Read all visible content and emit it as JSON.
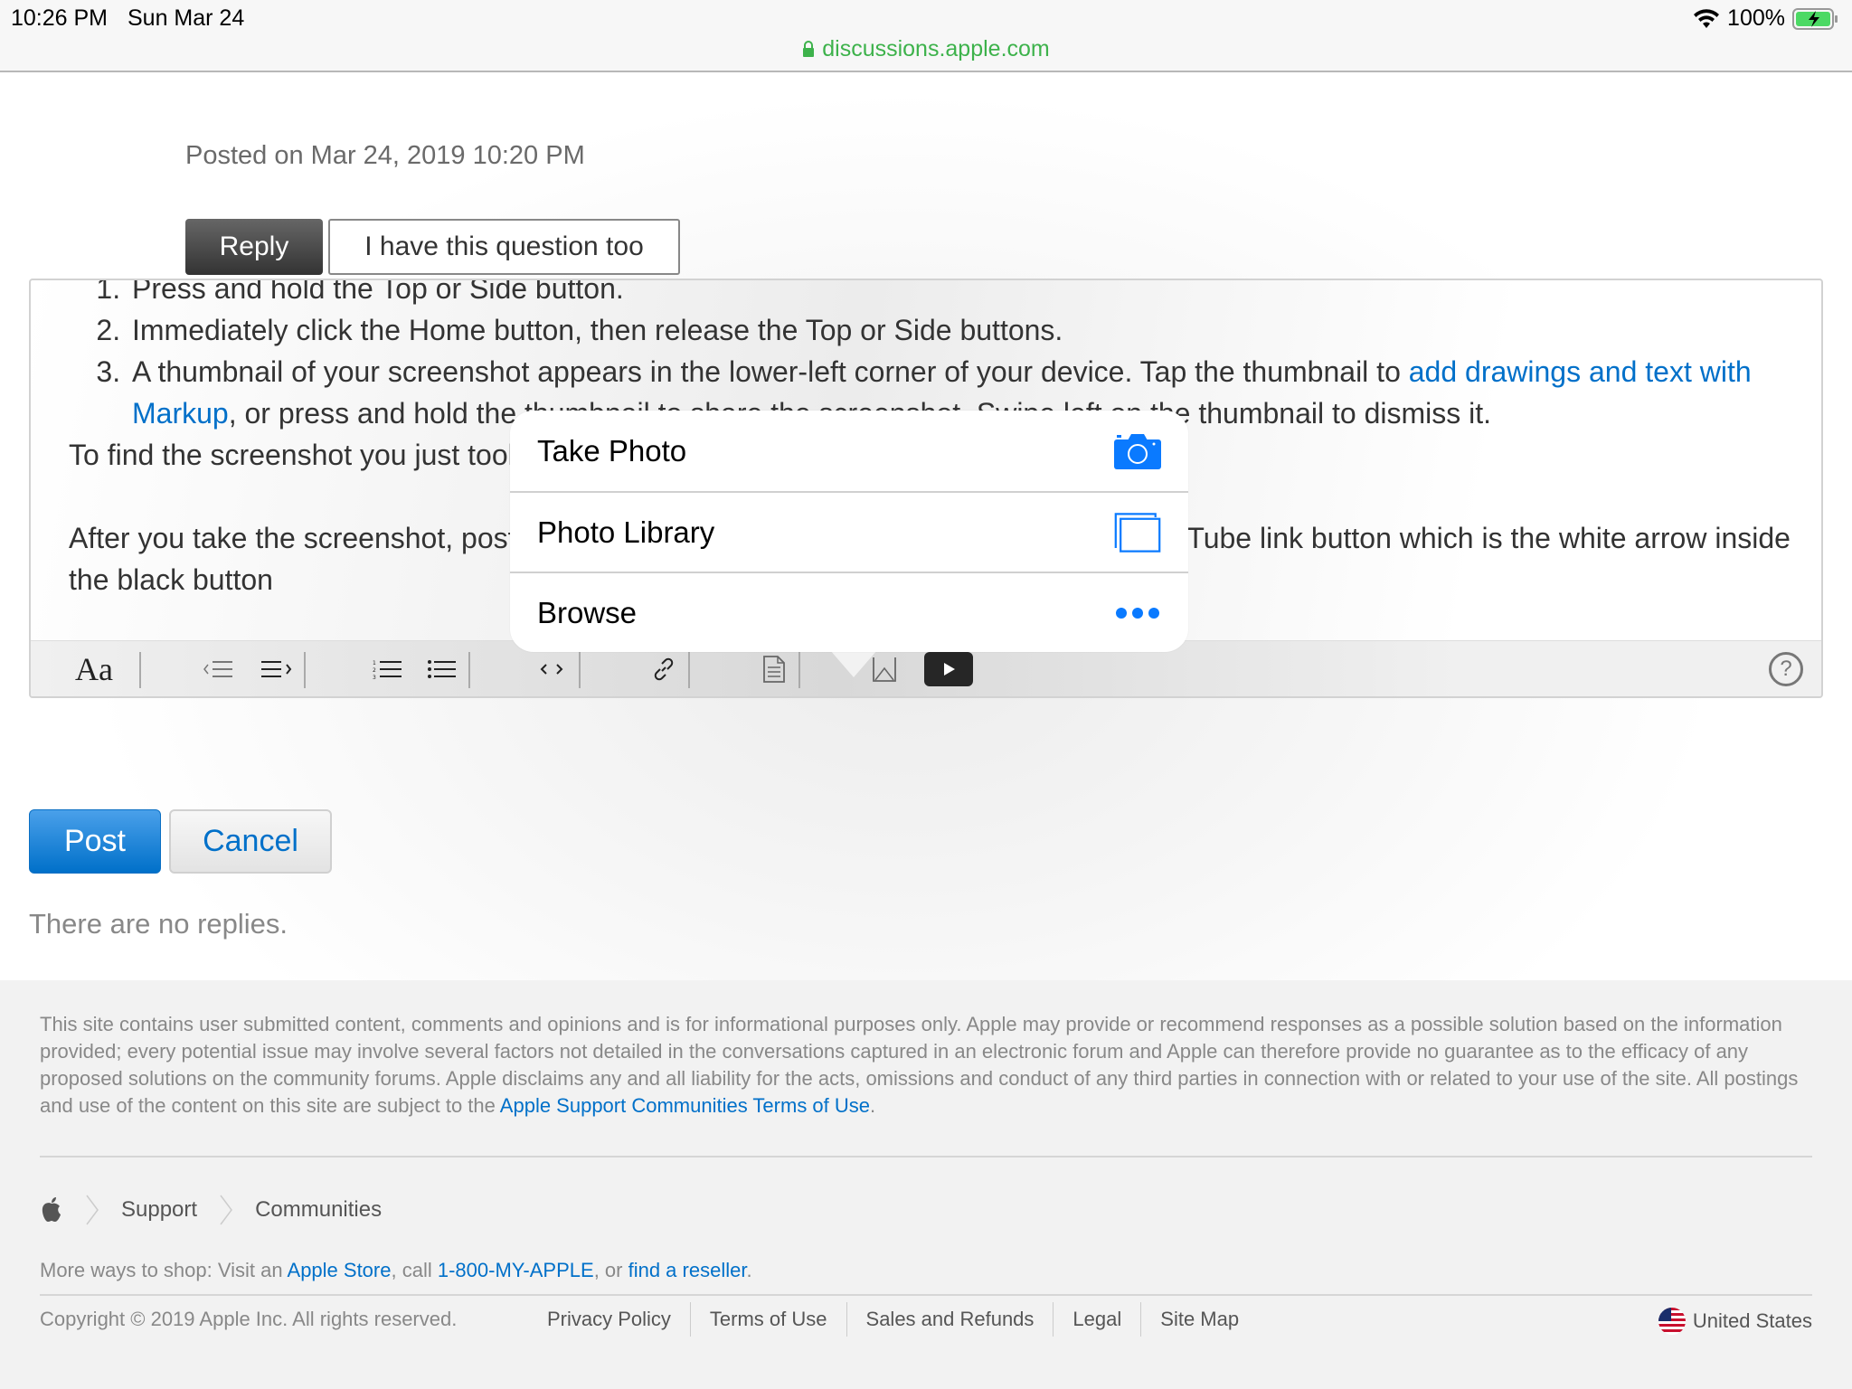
{
  "status_bar": {
    "time": "10:26 PM",
    "date": "Sun Mar 24",
    "battery": "100%",
    "url": "discussions.apple.com"
  },
  "post": {
    "posted": "Posted on Mar 24, 2019 10:20 PM",
    "reply_label": "Reply",
    "question_label": "I have this question too"
  },
  "editor": {
    "list_items": [
      {
        "text": "Press and hold the Top or Side button."
      },
      {
        "text": "Immediately click the Home button, then release the Top or Side buttons."
      },
      {
        "before": "A thumbnail of your screenshot appears in the lower-left corner of your device. Tap the thumbnail to ",
        "link": "add drawings and text with Markup",
        "after": ", or press and hold the thumbnail to share the screenshot. Swipe left on the thumbnail to dismiss it."
      }
    ],
    "paragraph1": "To find the screenshot you just took, go to Photos > Albums and tap Screenshots",
    "paragraph2": "After you take the screenshot, post it here using the Insert Image button next to the YouTube link button which is the white arrow inside the black button",
    "toolbar": {
      "font_label": "Aa",
      "help": "?"
    }
  },
  "popover": {
    "items": [
      {
        "label": "Take Photo",
        "icon": "camera-icon"
      },
      {
        "label": "Photo Library",
        "icon": "photo-library-icon"
      },
      {
        "label": "Browse",
        "icon": "more-icon"
      }
    ],
    "accent": "#0a7aff"
  },
  "actions": {
    "post_label": "Post",
    "cancel_label": "Cancel",
    "no_replies": "There are no replies."
  },
  "footer": {
    "disclaimer_text": "This site contains user submitted content, comments and opinions and is for informational purposes only. Apple may provide or recommend responses as a possible solution based on the information provided; every potential issue may involve several factors not detailed in the conversations captured in an electronic forum and Apple can therefore provide no guarantee as to the efficacy of any proposed solutions on the community forums. Apple disclaims any and all liability for the acts, omissions and conduct of any third parties in connection with or related to your use of the site. All postings and use of the content on this site are subject to the ",
    "disclaimer_link": "Apple Support Communities Terms of Use",
    "disclaimer_end": ".",
    "breadcrumb": [
      "Support",
      "Communities"
    ],
    "more_ways_prefix": "More ways to shop: Visit an ",
    "apple_store": "Apple Store",
    "more_ways_mid": ", call ",
    "phone": "1-800-MY-APPLE",
    "more_ways_or": ", or ",
    "reseller": "find a reseller",
    "more_ways_end": ".",
    "copyright": "Copyright © 2019 Apple Inc. All rights reserved.",
    "legal_links": [
      "Privacy Policy",
      "Terms of Use",
      "Sales and Refunds",
      "Legal",
      "Site Map"
    ],
    "locale": "United States"
  },
  "colors": {
    "link": "#0070c9",
    "url_green": "#3db24b",
    "post_button": "#0070c9"
  }
}
